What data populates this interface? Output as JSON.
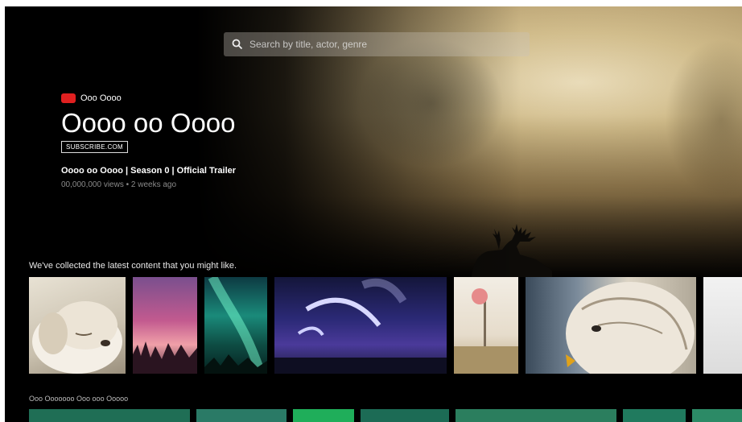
{
  "search": {
    "placeholder": "Search by title, actor, genre"
  },
  "hero": {
    "channel_name": "Ooo Oooo",
    "title": "Oooo oo Oooo",
    "subscribe_label": "SUBSCRIBE.COM",
    "video_title": "Oooo oo Oooo | Season 0 | Official Trailer",
    "video_meta": "00,000,000 views • 2 weeks ago"
  },
  "rows": [
    {
      "heading": "We've collected the latest content that you might like.",
      "items": [
        {
          "subject": "sleeping-dog",
          "color": "#d9d2c2"
        },
        {
          "subject": "pink-sunset-reeds",
          "color": "#c86a8a"
        },
        {
          "subject": "aurora",
          "color": "#1d7a6a"
        },
        {
          "subject": "planet-sky",
          "color": "#3a3aa0"
        },
        {
          "subject": "pink-tree",
          "color": "#e8dccc"
        },
        {
          "subject": "owl",
          "color": "#cfc4b4"
        },
        {
          "subject": "light-card",
          "color": "#e6e6e6"
        }
      ]
    },
    {
      "heading": "Ooo Ooooooo Ooo ooo Ooooo",
      "items": [
        {
          "subject": "teal-card-1",
          "color": "#1f6e55"
        },
        {
          "subject": "teal-card-2",
          "color": "#2a7a66"
        },
        {
          "subject": "green-card",
          "color": "#1fae5a"
        },
        {
          "subject": "teal-card-3",
          "color": "#1c6b55"
        },
        {
          "subject": "teal-card-4",
          "color": "#2b7e5e"
        },
        {
          "subject": "teal-card-5",
          "color": "#207a5e"
        },
        {
          "subject": "teal-card-6",
          "color": "#2c8a66"
        }
      ]
    }
  ]
}
